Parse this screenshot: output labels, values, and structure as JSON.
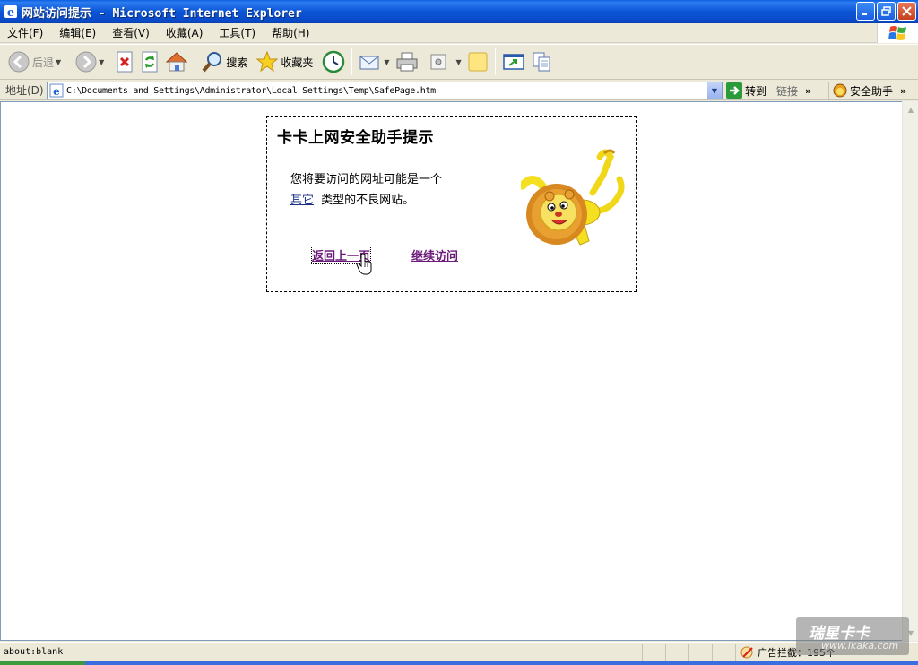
{
  "window": {
    "title": "网站访问提示 - Microsoft Internet Explorer"
  },
  "menu": {
    "items": [
      "文件(F)",
      "编辑(E)",
      "查看(V)",
      "收藏(A)",
      "工具(T)",
      "帮助(H)"
    ]
  },
  "toolbar": {
    "back_label": "后退",
    "search_label": "搜索",
    "favorites_label": "收藏夹"
  },
  "address": {
    "label": "地址(D)",
    "url": "C:\\Documents and Settings\\Administrator\\Local Settings\\Temp\\SafePage.htm",
    "go_label": "转到",
    "links_label": "链接",
    "helper_label": "安全助手"
  },
  "page": {
    "heading": "卡卡上网安全助手提示",
    "message_line1": "您将要访问的网址可能是一个",
    "category": "其它",
    "message_line2": "类型的不良网站。",
    "back_link": "返回上一页",
    "continue_link": "继续访问"
  },
  "status": {
    "text": "about:blank",
    "ad_block_label": "广告拦截：",
    "ad_block_count": "195个"
  },
  "watermark": {
    "brand": "瑞星卡卡",
    "url": "www.ikaka.com"
  }
}
